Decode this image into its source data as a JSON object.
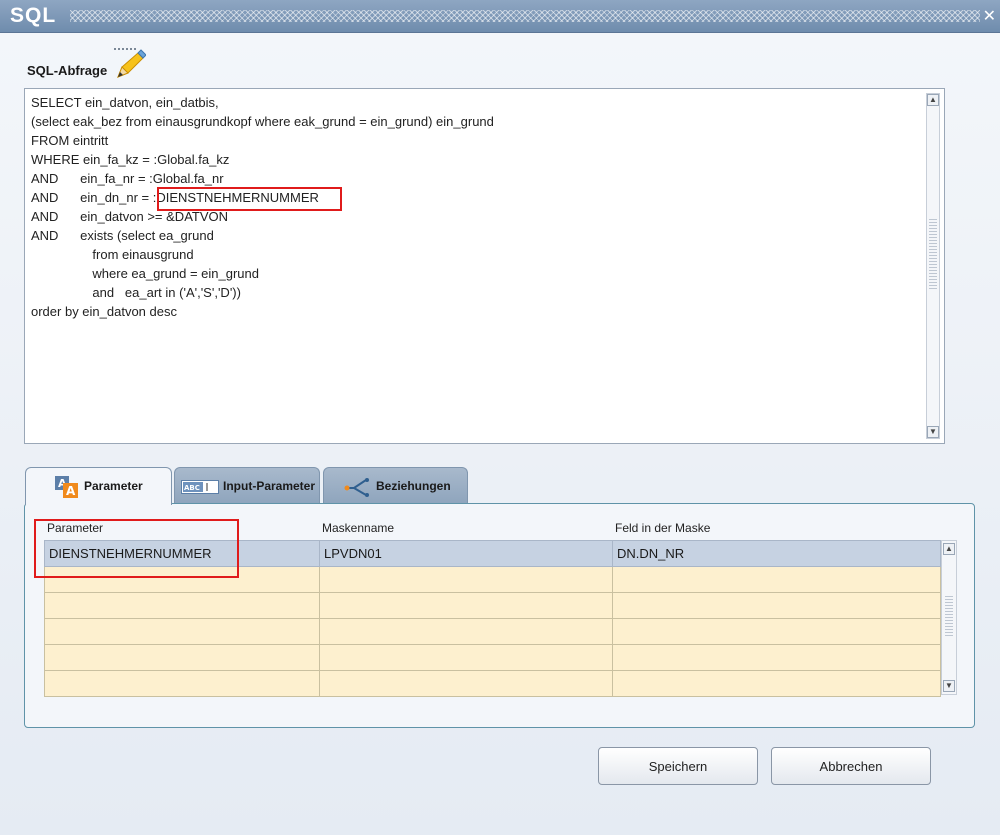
{
  "window": {
    "title": "SQL",
    "close_glyph": "✕"
  },
  "query": {
    "label": "SQL-Abfrage",
    "icon": "edit-pencil-icon",
    "text": "SELECT ein_datvon, ein_datbis,\n(select eak_bez from einausgrundkopf where eak_grund = ein_grund) ein_grund\nFROM eintritt\nWHERE ein_fa_kz = :Global.fa_kz\nAND      ein_fa_nr = :Global.fa_nr\nAND      ein_dn_nr = :DIENSTNEHMERNUMMER\nAND      ein_datvon >= &DATVON\nAND      exists (select ea_grund\n                 from einausgrund\n                 where ea_grund = ein_grund\n                 and   ea_art in ('A','S','D'))\norder by ein_datvon desc"
  },
  "tabs": [
    {
      "label": "Parameter",
      "icon": "parameter-icon",
      "active": true
    },
    {
      "label": "Input-Parameter",
      "icon": "input-field-icon",
      "active": false
    },
    {
      "label": "Beziehungen",
      "icon": "relation-icon",
      "active": false
    }
  ],
  "grid": {
    "columns": [
      "Parameter",
      "Maskenname",
      "Feld in der Maske"
    ],
    "rows": [
      [
        "DIENSTNEHMERNUMMER",
        "LPVDN01",
        "DN.DN_NR"
      ],
      [
        "",
        "",
        ""
      ],
      [
        "",
        "",
        ""
      ],
      [
        "",
        "",
        ""
      ],
      [
        "",
        "",
        ""
      ],
      [
        "",
        "",
        ""
      ]
    ]
  },
  "buttons": {
    "save": "Speichern",
    "cancel": "Abbrechen"
  },
  "colors": {
    "highlight": "#e01b1b",
    "row_empty": "#fdf0cf",
    "row_selected": "#c6d2e2"
  }
}
